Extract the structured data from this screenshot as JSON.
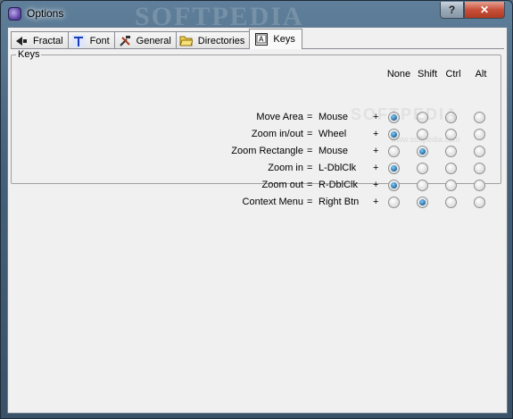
{
  "window": {
    "title": "Options",
    "help_label": "?",
    "close_label": "✕",
    "watermark": "SOFTPEDIA"
  },
  "tabs": [
    {
      "label": "Fractal",
      "icon": "fractal-icon"
    },
    {
      "label": "Font",
      "icon": "font-icon"
    },
    {
      "label": "General",
      "icon": "general-tools-icon"
    },
    {
      "label": "Directories",
      "icon": "folder-icon"
    },
    {
      "label": "Keys",
      "icon": "keys-icon",
      "active": true
    }
  ],
  "keys": {
    "group_title": "Keys",
    "columns": [
      "None",
      "Shift",
      "Ctrl",
      "Alt"
    ],
    "equals": "=",
    "plus": "+",
    "rows": [
      {
        "action": "Move Area",
        "input": "Mouse",
        "selected": "None"
      },
      {
        "action": "Zoom in/out",
        "input": "Wheel",
        "selected": "None"
      },
      {
        "action": "Zoom Rectangle",
        "input": "Mouse",
        "selected": "Shift"
      },
      {
        "action": "Zoom in",
        "input": "L-DblClk",
        "selected": "None"
      },
      {
        "action": "Zoom out",
        "input": "R-DblClk",
        "selected": "None"
      },
      {
        "action": "Context Menu",
        "input": "Right Btn",
        "selected": "Shift"
      }
    ],
    "watermark": "SOFTPEDIA",
    "watermark_url": "www.softpedia.com"
  }
}
